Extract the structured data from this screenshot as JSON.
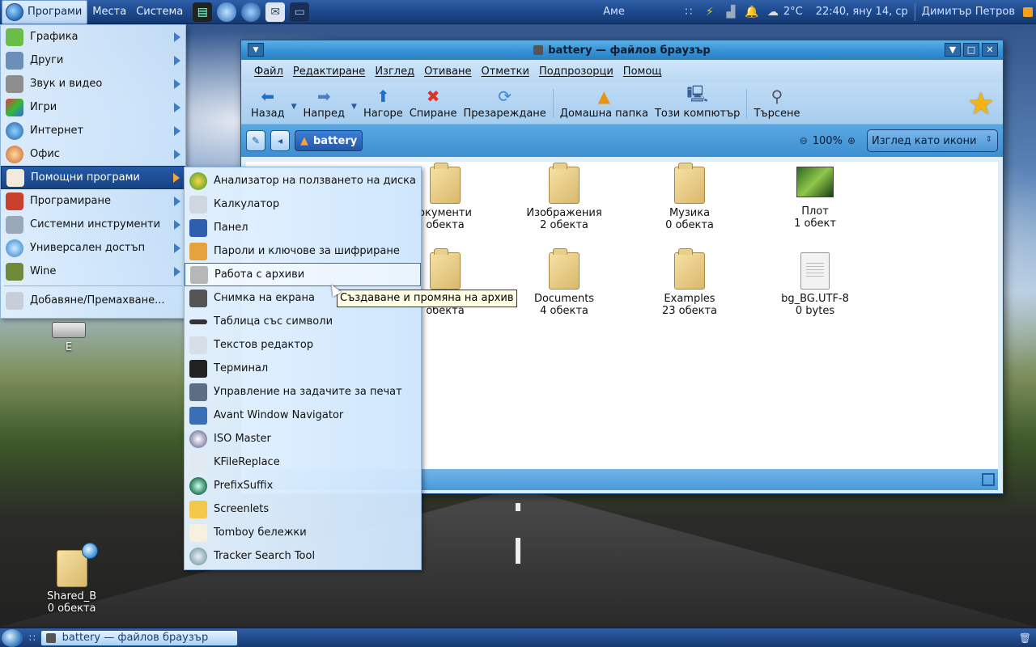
{
  "top_panel": {
    "menus": [
      "Програми",
      "Места",
      "Система"
    ],
    "launchers": [
      "terminal-launcher-icon",
      "globe-launcher-icon",
      "firefox-launcher-icon",
      "mail-launcher-icon",
      "screen-launcher-icon"
    ],
    "weather_location": "Аме",
    "temperature": "2°C",
    "clock": "22:40, яну 14, ср",
    "user": "Димитър Петров"
  },
  "apps_menu": {
    "items": [
      {
        "label": "Графика",
        "icon": "graphics-icon",
        "submenu": true
      },
      {
        "label": "Други",
        "icon": "other-icon",
        "submenu": true
      },
      {
        "label": "Звук и видео",
        "icon": "sound-video-icon",
        "submenu": true
      },
      {
        "label": "Игри",
        "icon": "games-icon",
        "submenu": true
      },
      {
        "label": "Интернет",
        "icon": "internet-icon",
        "submenu": true
      },
      {
        "label": "Офис",
        "icon": "office-icon",
        "submenu": true
      },
      {
        "label": "Помощни програми",
        "icon": "accessories-icon",
        "submenu": true,
        "active": true
      },
      {
        "label": "Програмиране",
        "icon": "programming-icon",
        "submenu": true
      },
      {
        "label": "Системни инструменти",
        "icon": "system-tools-icon",
        "submenu": true
      },
      {
        "label": "Универсален достъп",
        "icon": "accessibility-icon",
        "submenu": true
      },
      {
        "label": "Wine",
        "icon": "wine-icon",
        "submenu": true
      }
    ],
    "footer_item": "Добавяне/Премахване..."
  },
  "submenu": {
    "items": [
      "Анализатор на ползването на диска",
      "Калкулатор",
      "Панел",
      "Пароли и ключове за шифриране",
      "Работа с архиви",
      "Снимка на екрана",
      "Таблица със символи",
      "Текстов редактор",
      "Терминал",
      "Управление на задачите за печат",
      "Avant Window Navigator",
      "ISO Master",
      "KFileReplace",
      "PrefixSuffix",
      "Screenlets",
      "Tomboy бележки",
      "Tracker Search Tool"
    ],
    "selected_index": 4
  },
  "tooltip": "Създаване и промяна на архив",
  "window": {
    "title": "battery — файлов браузър",
    "menubar": [
      "Файл",
      "Редактиране",
      "Изглед",
      "Отиване",
      "Отметки",
      "Подпрозорци",
      "Помощ"
    ],
    "toolbar": {
      "back": "Назад",
      "forward": "Напред",
      "up": "Нагоре",
      "stop": "Спиране",
      "reload": "Презареждане",
      "home": "Домашна папка",
      "computer": "Този компютър",
      "search": "Търсене"
    },
    "location": {
      "path_button": "battery",
      "zoom": "100%",
      "view_mode": "Изглед като икони"
    },
    "files": [
      {
        "name": "окументи",
        "meta": "обекта",
        "icon": "folder-icon"
      },
      {
        "name": "Изображения",
        "meta": "2 обекта",
        "icon": "folder-icon"
      },
      {
        "name": "Музика",
        "meta": "0 обекта",
        "icon": "folder-icon"
      },
      {
        "name": "Плот",
        "meta": "1 обект",
        "icon": "desktop-image-icon"
      },
      {
        "name": "",
        "meta": "обекта",
        "icon": "folder-icon"
      },
      {
        "name": "Documents",
        "meta": "4 обекта",
        "icon": "folder-icon"
      },
      {
        "name": "Examples",
        "meta": "23 обекта",
        "icon": "folder-icon"
      },
      {
        "name": "bg_BG.UTF-8",
        "meta": "0 bytes",
        "icon": "document-icon"
      }
    ]
  },
  "desktop": {
    "drive_label": "E",
    "shared_label": "Shared_B",
    "shared_meta": "0 обекта"
  },
  "taskbar": {
    "task": "battery — файлов браузър"
  },
  "colors": {
    "panel": "#1d4a8e",
    "menu_highlight": "#245aa8",
    "titlebar": "#3592d4",
    "folder": "#d9b86a"
  }
}
